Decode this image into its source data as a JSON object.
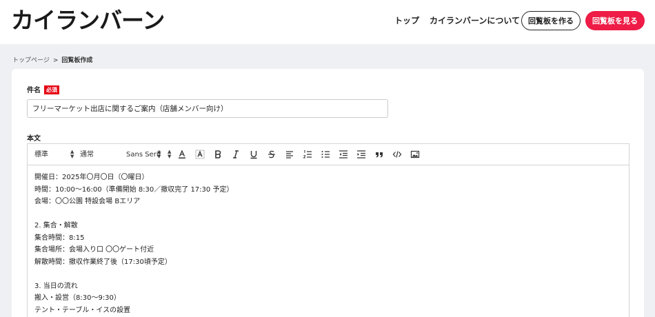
{
  "header": {
    "logo": "カイランバーン",
    "nav": [
      {
        "label": "トップ"
      },
      {
        "label": "カイランバーンについて"
      }
    ],
    "create_button": "回覧板を作る",
    "view_button": "回覧板を見る"
  },
  "breadcrumb": {
    "home": "トップページ",
    "separator": ">",
    "current": "回覧板作成"
  },
  "form": {
    "subject_label": "件名",
    "required_badge": "必須",
    "subject_value": "フリーマーケット出店に関するご案内（店舗メンバー向け）",
    "body_label": "本文"
  },
  "toolbar": {
    "size_select": "標準",
    "weight_select": "通常",
    "font_select": "Sans Serif",
    "icons": [
      "font-color-icon",
      "highlight-icon",
      "bold-icon",
      "italic-icon",
      "underline-icon",
      "strike-icon",
      "align-icon",
      "ordered-list-icon",
      "bullet-list-icon",
      "outdent-icon",
      "indent-icon",
      "blockquote-icon",
      "code-icon",
      "image-icon"
    ]
  },
  "body_lines": [
    "開催日：2025年〇月〇日（〇曜日）",
    "時間：10:00〜16:00（準備開始 8:30／撤収完了 17:30 予定）",
    "会場：〇〇公園 特設会場 Bエリア",
    "",
    "2. 集合・解散",
    "集合時間：8:15",
    "集合場所：会場入り口 〇〇ゲート付近",
    "解散時間：撤収作業終了後（17:30頃予定）",
    "",
    "3. 当日の流れ",
    "搬入・設営（8:30〜9:30）",
    "テント・テーブル・イスの設置"
  ],
  "colors": {
    "accent": "#ee1c46",
    "required": "#e60012",
    "page_bg": "#eef0f3"
  }
}
